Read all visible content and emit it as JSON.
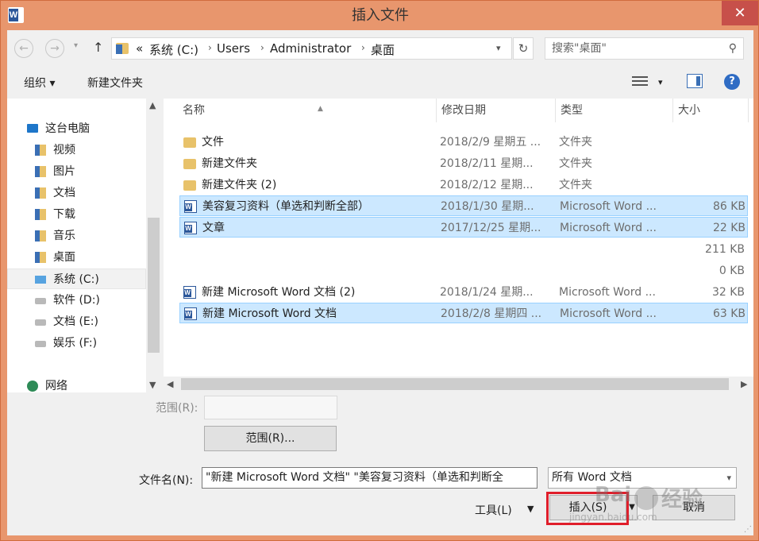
{
  "window": {
    "title": "插入文件",
    "app_icon": "word-icon",
    "close_label": "✕"
  },
  "nav": {
    "back_icon": "←",
    "forward_icon": "→",
    "history_icon": "▾",
    "up_icon": "↑",
    "breadcrumb": [
      "«",
      "系统 (C:)",
      "Users",
      "Administrator",
      "桌面"
    ],
    "search_placeholder": "搜索\"桌面\""
  },
  "toolbar": {
    "organize_label": "组织 ▾",
    "new_folder_label": "新建文件夹"
  },
  "sidebar": {
    "items": [
      {
        "label": "这台电脑",
        "icon": "computer-icon"
      },
      {
        "label": "视频",
        "icon": "library-icon"
      },
      {
        "label": "图片",
        "icon": "library-icon"
      },
      {
        "label": "文档",
        "icon": "library-icon"
      },
      {
        "label": "下载",
        "icon": "library-icon"
      },
      {
        "label": "音乐",
        "icon": "library-icon"
      },
      {
        "label": "桌面",
        "icon": "library-icon"
      },
      {
        "label": "系统 (C:)",
        "icon": "system-drive-icon",
        "selected": true
      },
      {
        "label": "软件 (D:)",
        "icon": "drive-icon"
      },
      {
        "label": "文档 (E:)",
        "icon": "drive-icon"
      },
      {
        "label": "娱乐 (F:)",
        "icon": "drive-icon"
      },
      {
        "label": "网络",
        "icon": "network-icon"
      }
    ]
  },
  "files": {
    "columns": [
      "名称",
      "修改日期",
      "类型",
      "大小"
    ],
    "rows": [
      {
        "name": "文件",
        "date": "2018/2/9 星期五 ...",
        "type": "文件夹",
        "size": "",
        "icon": "folder-icon",
        "selected": false
      },
      {
        "name": "新建文件夹",
        "date": "2018/2/11 星期...",
        "type": "文件夹",
        "size": "",
        "icon": "folder-icon",
        "selected": false
      },
      {
        "name": "新建文件夹 (2)",
        "date": "2018/2/12 星期...",
        "type": "文件夹",
        "size": "",
        "icon": "folder-icon",
        "selected": false
      },
      {
        "name": "美容复习资料（单选和判断全部）",
        "date": "2018/1/30 星期...",
        "type": "Microsoft Word ...",
        "size": "86 KB",
        "icon": "word-doc-icon",
        "selected": true
      },
      {
        "name": "文章",
        "date": "2017/12/25 星期...",
        "type": "Microsoft Word ...",
        "size": "22 KB",
        "icon": "word-doc-icon",
        "selected": true
      },
      {
        "name": "",
        "date": "",
        "type": "",
        "size": "211 KB",
        "icon": "",
        "selected": false
      },
      {
        "name": "",
        "date": "",
        "type": "",
        "size": "0 KB",
        "icon": "",
        "selected": false
      },
      {
        "name": "新建 Microsoft Word 文档 (2)",
        "date": "2018/1/24 星期...",
        "type": "Microsoft Word ...",
        "size": "32 KB",
        "icon": "word-doc-icon",
        "selected": false
      },
      {
        "name": "新建 Microsoft Word 文档",
        "date": "2018/2/8 星期四 ...",
        "type": "Microsoft Word ...",
        "size": "63 KB",
        "icon": "word-doc-icon",
        "selected": true
      }
    ]
  },
  "bottom": {
    "range_label": "范围(R):",
    "range_button": "范围(R)...",
    "filename_label": "文件名(N):",
    "filename_value": "\"新建 Microsoft Word 文档\" \"美容复习资料（单选和判断全",
    "filetype_value": "所有 Word 文档",
    "tools_label": "工具(L)",
    "insert_button": "插入(S)",
    "cancel_button": "取消"
  },
  "watermark": {
    "text": "经验",
    "brand": "Bai",
    "sub": "jingyan.baidu.com"
  },
  "colors": {
    "frame": "#e8966d",
    "close": "#c7504a",
    "selection": "#cce8ff",
    "highlight": "#e01e2b"
  }
}
